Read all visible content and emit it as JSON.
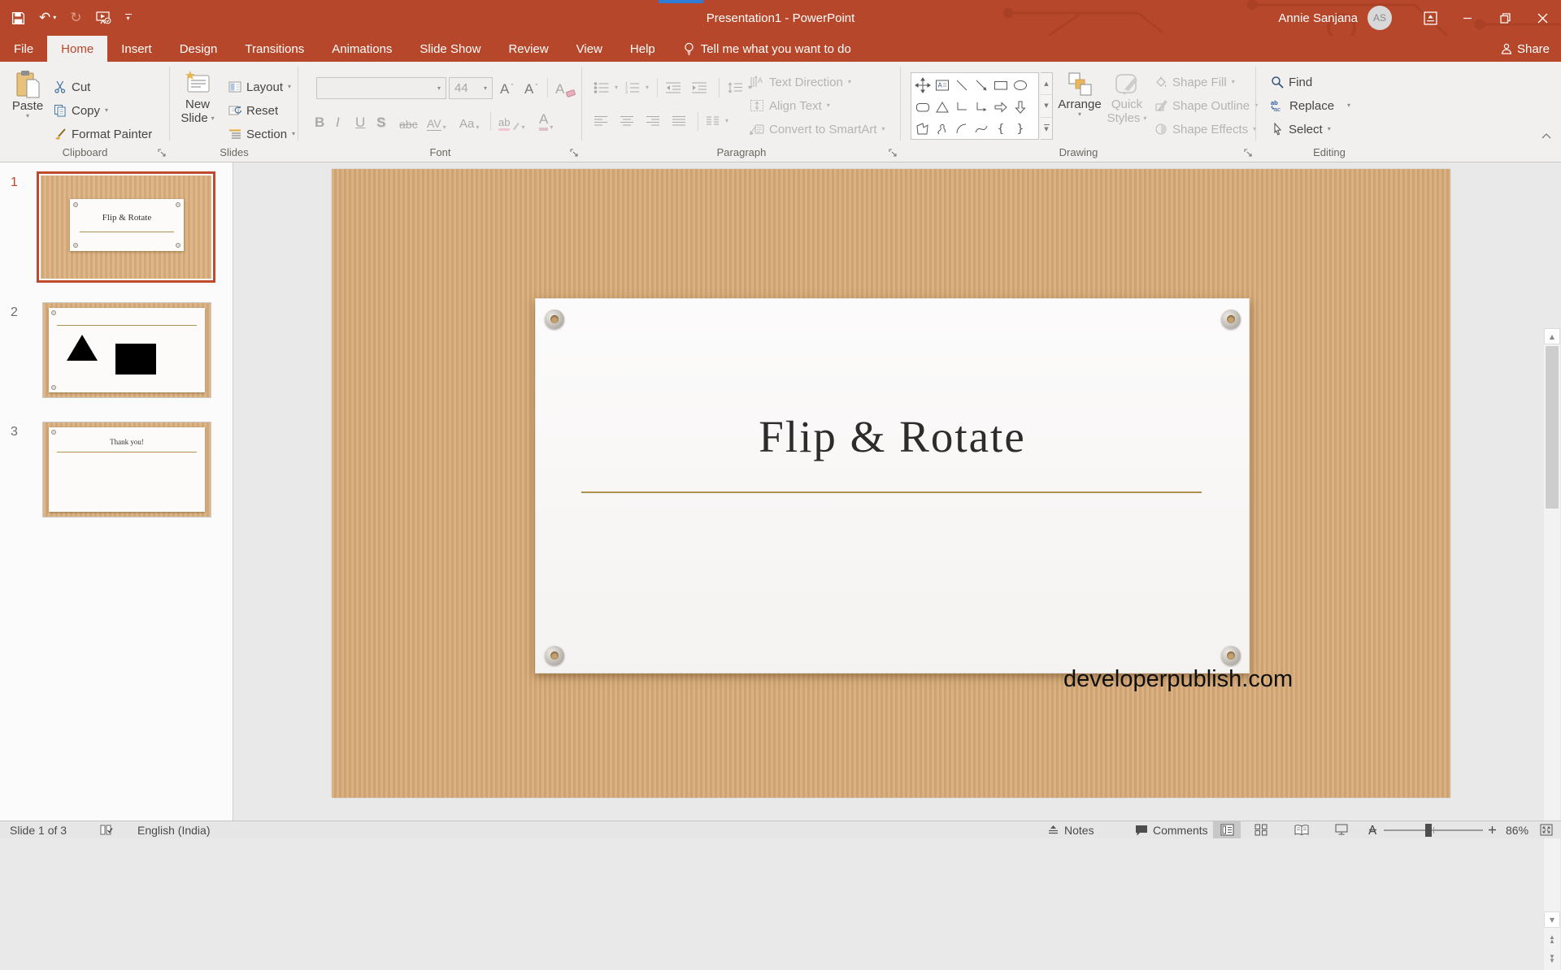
{
  "icons": {
    "undo": "↶",
    "redo": "↻",
    "caret": "▾",
    "scroll_up": "▲",
    "scroll_down": "▼",
    "brace_left": "{",
    "brace_right": "}",
    "grow_font": "A",
    "shrink_font": "A",
    "clear_format": "A"
  },
  "colors": {
    "brand": "#b7472a",
    "ribbon_bg": "#f1f0ee",
    "kraft_paper": "#d5ab7b",
    "gold_rule": "#b08f52",
    "disabled_text": "#b6b3b0",
    "accent_strip": "#2e7cd6"
  },
  "titlebar": {
    "title": "Presentation1 - PowerPoint",
    "user": "Annie Sanjana",
    "avatar": "AS"
  },
  "tabrow": {
    "file": "File",
    "tabs": [
      "Home",
      "Insert",
      "Design",
      "Transitions",
      "Animations",
      "Slide Show",
      "Review",
      "View",
      "Help"
    ],
    "active_tab": "Home",
    "tell_me": "Tell me what you want to do",
    "share": "Share"
  },
  "ribbon": {
    "clipboard": {
      "label": "Clipboard",
      "paste": "Paste",
      "cut": "Cut",
      "copy": "Copy",
      "format_painter": "Format Painter"
    },
    "slides": {
      "label": "Slides",
      "new_line1": "New",
      "new_line2": "Slide",
      "layout": "Layout",
      "reset": "Reset",
      "section": "Section"
    },
    "font": {
      "label": "Font",
      "size": "44",
      "bold": "B",
      "italic": "I",
      "underline": "U",
      "shadow": "S",
      "strikethrough": "abc",
      "char_spacing": "AV",
      "change_case": "Aa",
      "highlight": "ab",
      "font_color": "A"
    },
    "paragraph": {
      "label": "Paragraph",
      "text_direction": "Text Direction",
      "align_text": "Align Text",
      "smartart": "Convert to SmartArt"
    },
    "drawing": {
      "label": "Drawing",
      "arrange": "Arrange",
      "quick1": "Quick",
      "quick2": "Styles",
      "fill": "Shape Fill",
      "outline": "Shape Outline",
      "effects": "Shape Effects"
    },
    "editing": {
      "label": "Editing",
      "find": "Find",
      "replace": "Replace",
      "select": "Select"
    }
  },
  "thumbnails": [
    {
      "number": "1",
      "title": "Flip & Rotate",
      "selected": true
    },
    {
      "number": "2",
      "selected": false
    },
    {
      "number": "3",
      "title": "Thank you!",
      "selected": false
    }
  ],
  "slide": {
    "title": "Flip & Rotate",
    "watermark": "developerpublish.com"
  },
  "statusbar": {
    "slide_indicator": "Slide 1 of 3",
    "language": "English (India)",
    "notes": "Notes",
    "comments": "Comments",
    "zoom": "86%"
  }
}
